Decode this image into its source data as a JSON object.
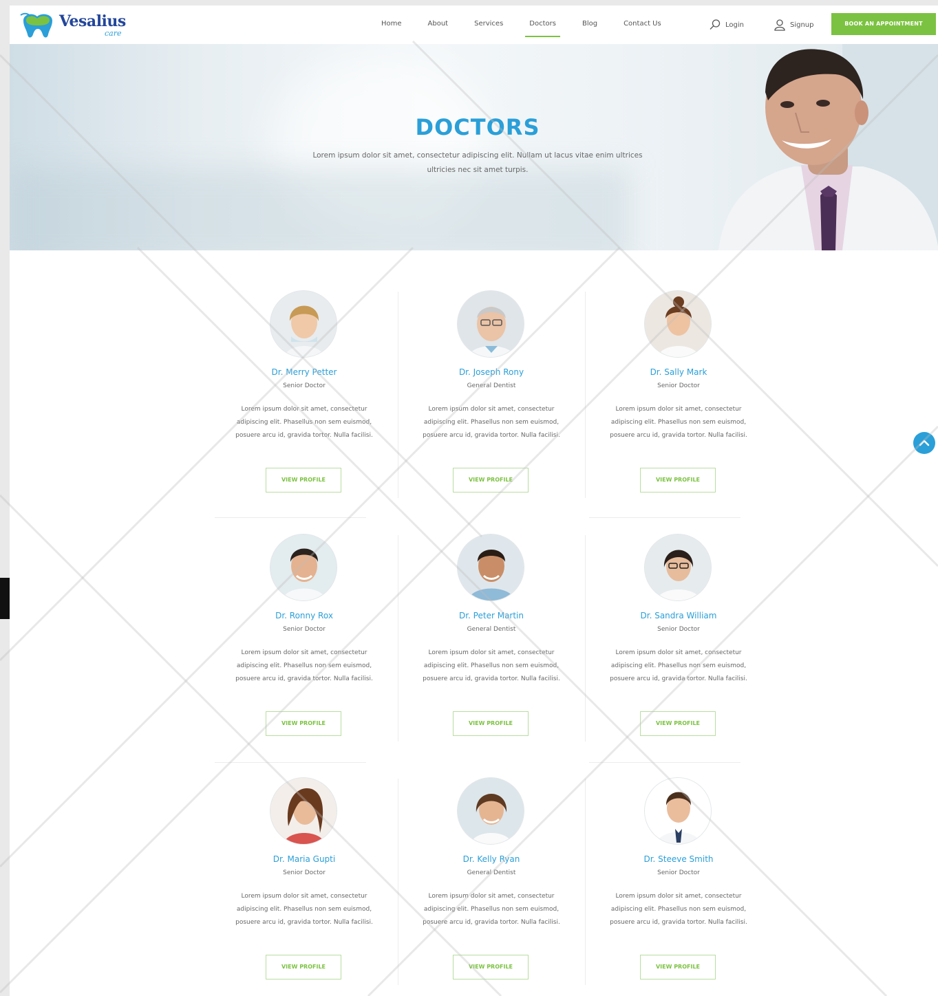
{
  "brand": {
    "name": "Vesalius",
    "tagline": "care"
  },
  "nav": {
    "items": [
      {
        "label": "Home"
      },
      {
        "label": "About"
      },
      {
        "label": "Services"
      },
      {
        "label": "Doctors",
        "active": true
      },
      {
        "label": "Blog"
      },
      {
        "label": "Contact Us"
      }
    ],
    "login_label": "Login",
    "signup_label": "Signup",
    "book_label": "BOOK AN APPOINTMENT"
  },
  "hero": {
    "title": "DOCTORS",
    "text": "Lorem ipsum dolor sit amet, consectetur adipiscing elit. Nullam ut lacus vitae enim ultrices ultricies nec sit amet turpis."
  },
  "doctors": [
    {
      "name": "Dr. Merry Petter",
      "role": "Senior Doctor",
      "bio": "Lorem ipsum dolor sit amet, consectetur adipiscing elit. Phasellus non sem euismod, posuere arcu id, gravida tortor. Nulla facilisi.",
      "button": "VIEW PROFILE"
    },
    {
      "name": "Dr. Joseph Rony",
      "role": "General Dentist",
      "bio": "Lorem ipsum dolor sit amet, consectetur adipiscing elit. Phasellus non sem euismod, posuere arcu id, gravida tortor. Nulla facilisi.",
      "button": "VIEW PROFILE"
    },
    {
      "name": "Dr. Sally Mark",
      "role": "Senior Doctor",
      "bio": "Lorem ipsum dolor sit amet, consectetur adipiscing elit. Phasellus non sem euismod, posuere arcu id, gravida tortor. Nulla facilisi.",
      "button": "VIEW PROFILE"
    },
    {
      "name": "Dr. Ronny Rox",
      "role": "Senior Doctor",
      "bio": "Lorem ipsum dolor sit amet, consectetur adipiscing elit. Phasellus non sem euismod, posuere arcu id, gravida tortor. Nulla facilisi.",
      "button": "VIEW PROFILE"
    },
    {
      "name": "Dr. Peter Martin",
      "role": "General Dentist",
      "bio": "Lorem ipsum dolor sit amet, consectetur adipiscing elit. Phasellus non sem euismod, posuere arcu id, gravida tortor. Nulla facilisi.",
      "button": "VIEW PROFILE"
    },
    {
      "name": "Dr. Sandra William",
      "role": "Senior Doctor",
      "bio": "Lorem ipsum dolor sit amet, consectetur adipiscing elit. Phasellus non sem euismod, posuere arcu id, gravida tortor. Nulla facilisi.",
      "button": "VIEW PROFILE"
    },
    {
      "name": "Dr. Maria Gupti",
      "role": "Senior Doctor",
      "bio": "Lorem ipsum dolor sit amet, consectetur adipiscing elit. Phasellus non sem euismod, posuere arcu id, gravida tortor. Nulla facilisi.",
      "button": "VIEW PROFILE"
    },
    {
      "name": "Dr. Kelly Ryan",
      "role": "General Dentist",
      "bio": "Lorem ipsum dolor sit amet, consectetur adipiscing elit. Phasellus non sem euismod, posuere arcu id, gravida tortor. Nulla facilisi.",
      "button": "VIEW PROFILE"
    },
    {
      "name": "Dr. Steeve Smith",
      "role": "Senior Doctor",
      "bio": "Lorem ipsum dolor sit amet, consectetur adipiscing elit. Phasellus non sem euismod, posuere arcu id, gravida tortor. Nulla facilisi.",
      "button": "VIEW PROFILE"
    }
  ],
  "colors": {
    "accent_green": "#7cc242",
    "accent_blue": "#2a9fd8",
    "brand_navy": "#23469b"
  },
  "icons": {
    "login": "search-icon",
    "signup": "user-icon",
    "scroll_top": "chevron-up-icon"
  }
}
